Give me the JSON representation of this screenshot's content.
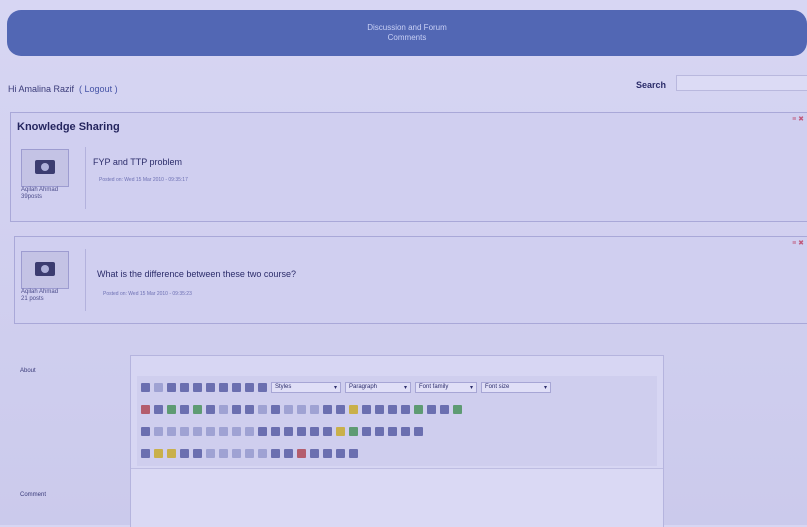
{
  "banner": {
    "line1": "Discussion and Forum",
    "line2": "Comments"
  },
  "header": {
    "greeting": "Hi Amalina Razif",
    "logout": "( Logout )",
    "search_label": "Search"
  },
  "knowledge": {
    "title": "Knowledge Sharing",
    "controls": "≡ ✖"
  },
  "posts": [
    {
      "author": "Aqilah Ahmad",
      "posts": "39posts",
      "title": "FYP and TTP problem",
      "meta": "Posted on: Wed 15 Mar 2010 - 09:35:17"
    },
    {
      "author": "Aqilah Ahmad",
      "posts": "21 posts",
      "title": "What is the difference between these two course?",
      "meta": "Posted on: Wed 15 Mar 2010 - 09:35:23"
    }
  ],
  "form": {
    "label_about": "About",
    "label_comment": "Comment"
  },
  "editor": {
    "styles": "Styles",
    "format": "Paragraph",
    "font_family": "Font family",
    "font_size": "Font size"
  }
}
